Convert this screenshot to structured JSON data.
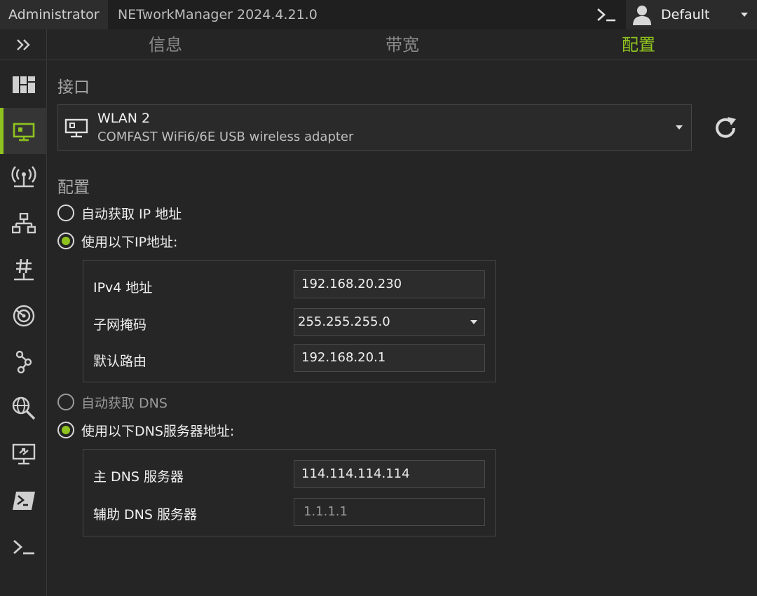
{
  "titlebar": {
    "user": "Administrator",
    "app_title": "NETworkManager 2024.4.21.0",
    "profile_name": "Default"
  },
  "tabs": [
    {
      "label": "信息",
      "active": false
    },
    {
      "label": "带宽",
      "active": false
    },
    {
      "label": "配置",
      "active": true
    }
  ],
  "interface": {
    "section_title": "接口",
    "name": "WLAN 2",
    "description": "COMFAST WiFi6/6E USB wireless adapter"
  },
  "config": {
    "section_title": "配置",
    "ip_auto_label": "自动获取 IP 地址",
    "ip_manual_label": "使用以下IP地址:",
    "ipv4_label": "IPv4 地址",
    "ipv4_value": "192.168.20.230",
    "subnet_label": "子网掩码",
    "subnet_value": "255.255.255.0",
    "gateway_label": "默认路由",
    "gateway_value": "192.168.20.1",
    "dns_auto_label": "自动获取 DNS",
    "dns_manual_label": "使用以下DNS服务器地址:",
    "dns_primary_label": "主 DNS 服务器",
    "dns_primary_value": "114.114.114.114",
    "dns_secondary_label": "辅助 DNS 服务器",
    "dns_secondary_placeholder": "1.1.1.1"
  },
  "colors": {
    "accent": "#8fc31f",
    "background": "#252525"
  }
}
